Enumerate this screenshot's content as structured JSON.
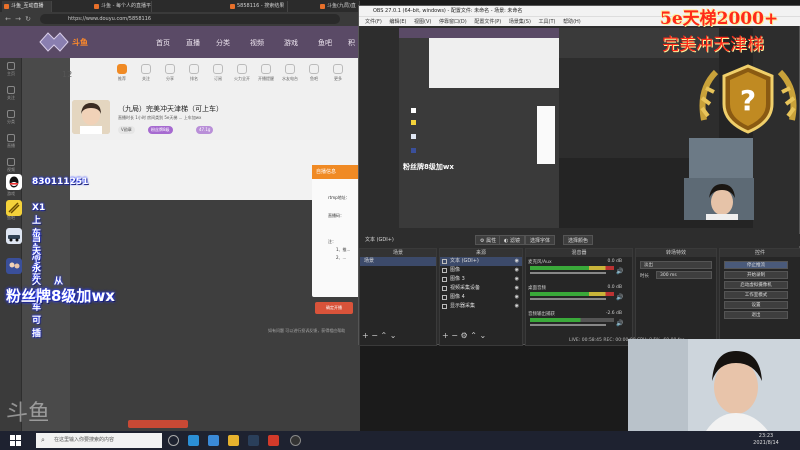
{
  "browser": {
    "tabs": [
      "斗鱼_互动直播",
      "斗鱼 - 每个人的直播平台",
      "5858116 - 搜索结果 - 斗鱼直播",
      "斗鱼(九局)直播 ..."
    ],
    "url": "https://www.douyu.com/5858116"
  },
  "site": {
    "nav": [
      "首页",
      "直播",
      "分类",
      "视频",
      "游戏",
      "鱼吧",
      "积"
    ],
    "sidebar": [
      "主页",
      "关注",
      "分类",
      "直播",
      "视频",
      "游戏",
      "鱼吧",
      "更多"
    ],
    "stats": [
      "推荐",
      "关注",
      "分享",
      "排名",
      "订阅",
      "火力全开",
      "开播提醒",
      "水友电台",
      "鱼吧",
      "更多"
    ],
    "count": "12"
  },
  "room": {
    "title": "（九局）完美冲天津梯（可上车）",
    "info": "直播时长 1小时  房间类别 5e天梯  ...  上车加wx",
    "tags": [
      "V勋章",
      "粉丝牌8级",
      "47.1g"
    ]
  },
  "dialog": {
    "title": "自播信息",
    "rtmp_label": "rtmp地址：",
    "key_label": "直播码：",
    "notes": [
      "注：",
      "1、推...",
      "2、..."
    ],
    "button": "确定开播",
    "hint": "如有问题 可以进行投诉反馈，获得相应帮助"
  },
  "overlay": {
    "qq": "830111251",
    "line2": "X1 上车1局",
    "line3": "当天上车",
    "line4": "永久上车可插",
    "from": "从",
    "fans": "粉丝牌8级加wx"
  },
  "taskbar": {
    "search_placeholder": "在这里输入你要搜索的内容",
    "time": "23:23",
    "date": "2021/8/14"
  },
  "obs": {
    "title": "OBS 27.0.1 (64-bit, windows) - 配置文件: 未命名 - 场景: 未命名",
    "menu": [
      "文件(F)",
      "编辑(E)",
      "视图(V)",
      "停靠窗口(D)",
      "配置文件(P)",
      "场景集(S)",
      "工具(T)",
      "帮助(H)"
    ],
    "toolbar": [
      "文本 (GDI+)",
      "属性",
      "滤镜",
      "选择字体",
      "选择颜色"
    ],
    "scenes_header": "场景",
    "scenes": [
      "场景"
    ],
    "sources_header": "来源",
    "sources": [
      "文本 (GDI+)",
      "图像",
      "图像 3",
      "视频采集设备",
      "图像 4",
      "显示器采集"
    ],
    "mixer_header": "混音器",
    "mixer": [
      {
        "name": "麦克风/Aux",
        "db": "0.0 dB"
      },
      {
        "name": "桌面音频",
        "db": "0.0 dB"
      },
      {
        "name": "音频输出捕获",
        "db": "-2.6 dB"
      }
    ],
    "transitions_header": "转场特效",
    "transition": "淡出",
    "duration_label": "时长",
    "duration": "300 ms",
    "controls_header": "控件",
    "controls": [
      "停止推流",
      "开始录制",
      "启动虚拟摄像机",
      "工作室模式",
      "设置",
      "退出"
    ],
    "status": "LIVE: 00:58:45   REC: 00:00:00   CPU: 8.5%, 60.00 fps"
  },
  "stream": {
    "title1": "5e天梯2000+",
    "title2": "完美冲天津梯"
  },
  "colors": {
    "accent": "#f08a24",
    "obs_bg": "#2d2d2d",
    "site_header": "#5a4a66",
    "title_red": "#ff2a1a"
  }
}
